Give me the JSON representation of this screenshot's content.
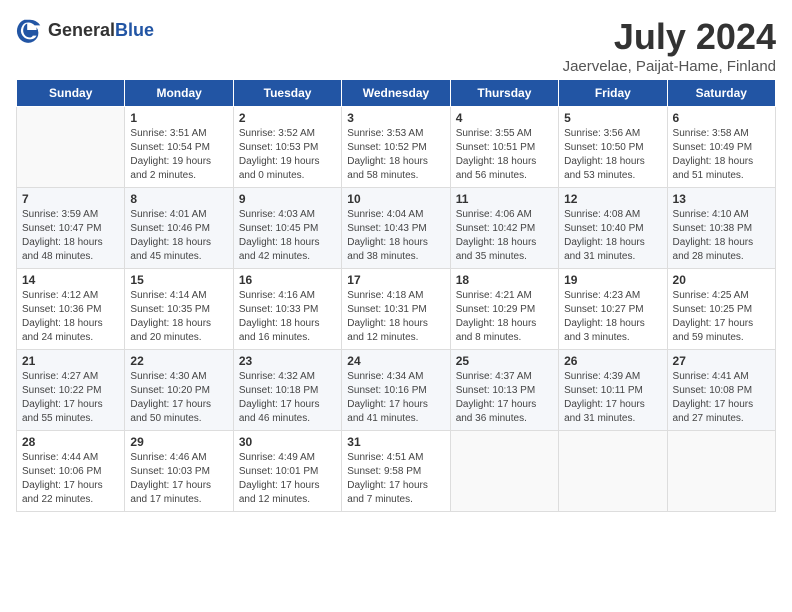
{
  "header": {
    "logo_general": "General",
    "logo_blue": "Blue",
    "month": "July 2024",
    "location": "Jaervelae, Paijat-Hame, Finland"
  },
  "weekdays": [
    "Sunday",
    "Monday",
    "Tuesday",
    "Wednesday",
    "Thursday",
    "Friday",
    "Saturday"
  ],
  "weeks": [
    [
      {
        "day": "",
        "sunrise": "",
        "sunset": "",
        "daylight": ""
      },
      {
        "day": "1",
        "sunrise": "Sunrise: 3:51 AM",
        "sunset": "Sunset: 10:54 PM",
        "daylight": "Daylight: 19 hours and 2 minutes."
      },
      {
        "day": "2",
        "sunrise": "Sunrise: 3:52 AM",
        "sunset": "Sunset: 10:53 PM",
        "daylight": "Daylight: 19 hours and 0 minutes."
      },
      {
        "day": "3",
        "sunrise": "Sunrise: 3:53 AM",
        "sunset": "Sunset: 10:52 PM",
        "daylight": "Daylight: 18 hours and 58 minutes."
      },
      {
        "day": "4",
        "sunrise": "Sunrise: 3:55 AM",
        "sunset": "Sunset: 10:51 PM",
        "daylight": "Daylight: 18 hours and 56 minutes."
      },
      {
        "day": "5",
        "sunrise": "Sunrise: 3:56 AM",
        "sunset": "Sunset: 10:50 PM",
        "daylight": "Daylight: 18 hours and 53 minutes."
      },
      {
        "day": "6",
        "sunrise": "Sunrise: 3:58 AM",
        "sunset": "Sunset: 10:49 PM",
        "daylight": "Daylight: 18 hours and 51 minutes."
      }
    ],
    [
      {
        "day": "7",
        "sunrise": "Sunrise: 3:59 AM",
        "sunset": "Sunset: 10:47 PM",
        "daylight": "Daylight: 18 hours and 48 minutes."
      },
      {
        "day": "8",
        "sunrise": "Sunrise: 4:01 AM",
        "sunset": "Sunset: 10:46 PM",
        "daylight": "Daylight: 18 hours and 45 minutes."
      },
      {
        "day": "9",
        "sunrise": "Sunrise: 4:03 AM",
        "sunset": "Sunset: 10:45 PM",
        "daylight": "Daylight: 18 hours and 42 minutes."
      },
      {
        "day": "10",
        "sunrise": "Sunrise: 4:04 AM",
        "sunset": "Sunset: 10:43 PM",
        "daylight": "Daylight: 18 hours and 38 minutes."
      },
      {
        "day": "11",
        "sunrise": "Sunrise: 4:06 AM",
        "sunset": "Sunset: 10:42 PM",
        "daylight": "Daylight: 18 hours and 35 minutes."
      },
      {
        "day": "12",
        "sunrise": "Sunrise: 4:08 AM",
        "sunset": "Sunset: 10:40 PM",
        "daylight": "Daylight: 18 hours and 31 minutes."
      },
      {
        "day": "13",
        "sunrise": "Sunrise: 4:10 AM",
        "sunset": "Sunset: 10:38 PM",
        "daylight": "Daylight: 18 hours and 28 minutes."
      }
    ],
    [
      {
        "day": "14",
        "sunrise": "Sunrise: 4:12 AM",
        "sunset": "Sunset: 10:36 PM",
        "daylight": "Daylight: 18 hours and 24 minutes."
      },
      {
        "day": "15",
        "sunrise": "Sunrise: 4:14 AM",
        "sunset": "Sunset: 10:35 PM",
        "daylight": "Daylight: 18 hours and 20 minutes."
      },
      {
        "day": "16",
        "sunrise": "Sunrise: 4:16 AM",
        "sunset": "Sunset: 10:33 PM",
        "daylight": "Daylight: 18 hours and 16 minutes."
      },
      {
        "day": "17",
        "sunrise": "Sunrise: 4:18 AM",
        "sunset": "Sunset: 10:31 PM",
        "daylight": "Daylight: 18 hours and 12 minutes."
      },
      {
        "day": "18",
        "sunrise": "Sunrise: 4:21 AM",
        "sunset": "Sunset: 10:29 PM",
        "daylight": "Daylight: 18 hours and 8 minutes."
      },
      {
        "day": "19",
        "sunrise": "Sunrise: 4:23 AM",
        "sunset": "Sunset: 10:27 PM",
        "daylight": "Daylight: 18 hours and 3 minutes."
      },
      {
        "day": "20",
        "sunrise": "Sunrise: 4:25 AM",
        "sunset": "Sunset: 10:25 PM",
        "daylight": "Daylight: 17 hours and 59 minutes."
      }
    ],
    [
      {
        "day": "21",
        "sunrise": "Sunrise: 4:27 AM",
        "sunset": "Sunset: 10:22 PM",
        "daylight": "Daylight: 17 hours and 55 minutes."
      },
      {
        "day": "22",
        "sunrise": "Sunrise: 4:30 AM",
        "sunset": "Sunset: 10:20 PM",
        "daylight": "Daylight: 17 hours and 50 minutes."
      },
      {
        "day": "23",
        "sunrise": "Sunrise: 4:32 AM",
        "sunset": "Sunset: 10:18 PM",
        "daylight": "Daylight: 17 hours and 46 minutes."
      },
      {
        "day": "24",
        "sunrise": "Sunrise: 4:34 AM",
        "sunset": "Sunset: 10:16 PM",
        "daylight": "Daylight: 17 hours and 41 minutes."
      },
      {
        "day": "25",
        "sunrise": "Sunrise: 4:37 AM",
        "sunset": "Sunset: 10:13 PM",
        "daylight": "Daylight: 17 hours and 36 minutes."
      },
      {
        "day": "26",
        "sunrise": "Sunrise: 4:39 AM",
        "sunset": "Sunset: 10:11 PM",
        "daylight": "Daylight: 17 hours and 31 minutes."
      },
      {
        "day": "27",
        "sunrise": "Sunrise: 4:41 AM",
        "sunset": "Sunset: 10:08 PM",
        "daylight": "Daylight: 17 hours and 27 minutes."
      }
    ],
    [
      {
        "day": "28",
        "sunrise": "Sunrise: 4:44 AM",
        "sunset": "Sunset: 10:06 PM",
        "daylight": "Daylight: 17 hours and 22 minutes."
      },
      {
        "day": "29",
        "sunrise": "Sunrise: 4:46 AM",
        "sunset": "Sunset: 10:03 PM",
        "daylight": "Daylight: 17 hours and 17 minutes."
      },
      {
        "day": "30",
        "sunrise": "Sunrise: 4:49 AM",
        "sunset": "Sunset: 10:01 PM",
        "daylight": "Daylight: 17 hours and 12 minutes."
      },
      {
        "day": "31",
        "sunrise": "Sunrise: 4:51 AM",
        "sunset": "Sunset: 9:58 PM",
        "daylight": "Daylight: 17 hours and 7 minutes."
      },
      {
        "day": "",
        "sunrise": "",
        "sunset": "",
        "daylight": ""
      },
      {
        "day": "",
        "sunrise": "",
        "sunset": "",
        "daylight": ""
      },
      {
        "day": "",
        "sunrise": "",
        "sunset": "",
        "daylight": ""
      }
    ]
  ]
}
